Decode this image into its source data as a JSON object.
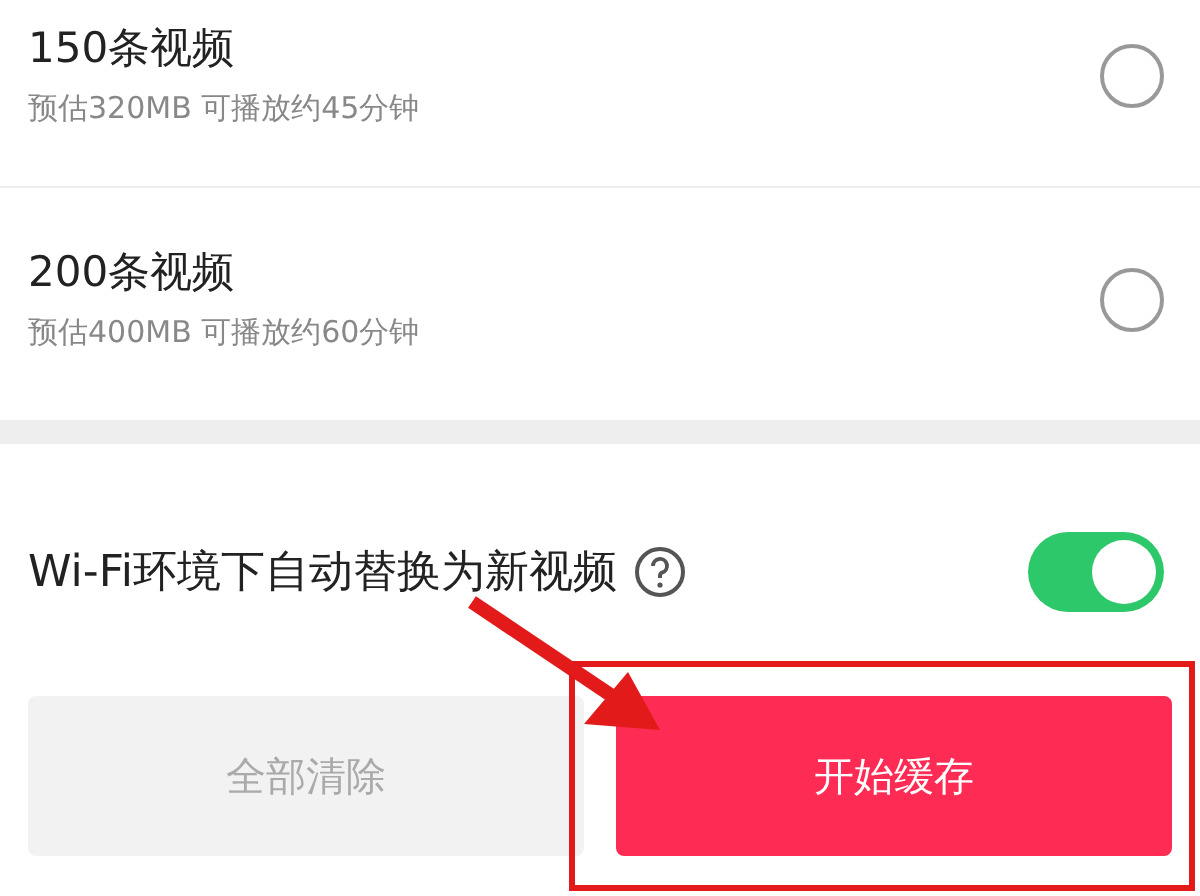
{
  "options": [
    {
      "title": "150条视频",
      "detail": "预估320MB 可播放约45分钟",
      "selected": false
    },
    {
      "title": "200条视频",
      "detail": "预估400MB 可播放约60分钟",
      "selected": false
    }
  ],
  "auto_replace": {
    "label": "Wi-Fi环境下自动替换为新视频",
    "on": true
  },
  "buttons": [
    {
      "label": "全部清除",
      "kind": "secondary"
    },
    {
      "label": "开始缓存",
      "kind": "primary"
    }
  ]
}
